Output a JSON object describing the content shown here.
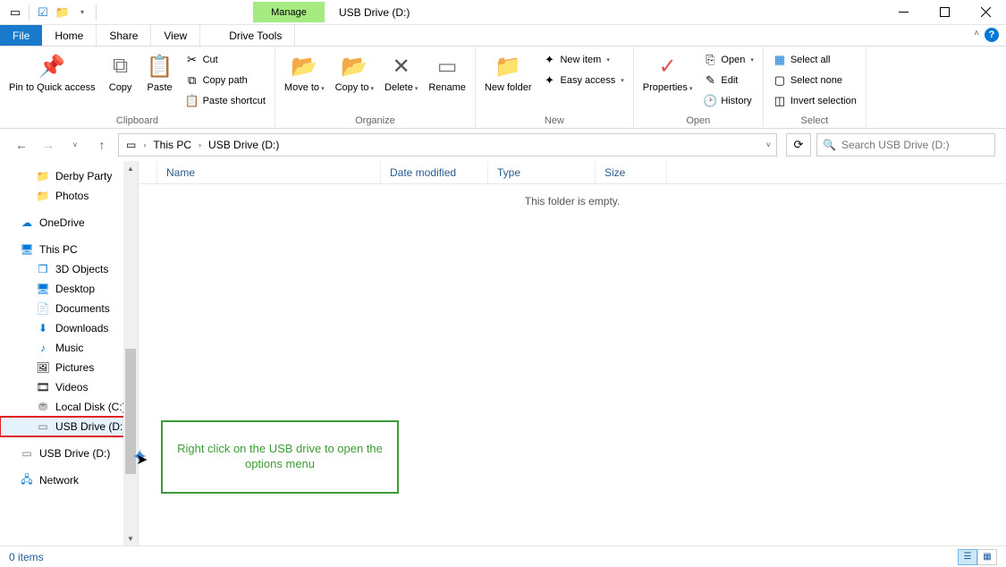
{
  "titlebar": {
    "manage": "Manage",
    "title": "USB Drive (D:)"
  },
  "tabs": {
    "file": "File",
    "home": "Home",
    "share": "Share",
    "view": "View",
    "drivetools": "Drive Tools"
  },
  "ribbon": {
    "clipboard": {
      "label": "Clipboard",
      "pin": "Pin to Quick access",
      "copy": "Copy",
      "paste": "Paste",
      "cut": "Cut",
      "copypath": "Copy path",
      "pasteshortcut": "Paste shortcut"
    },
    "organize": {
      "label": "Organize",
      "moveto": "Move to",
      "copyto": "Copy to",
      "delete": "Delete",
      "rename": "Rename"
    },
    "new": {
      "label": "New",
      "newfolder": "New folder",
      "newitem": "New item",
      "easyaccess": "Easy access"
    },
    "open": {
      "label": "Open",
      "properties": "Properties",
      "open": "Open",
      "edit": "Edit",
      "history": "History"
    },
    "select": {
      "label": "Select",
      "selectall": "Select all",
      "selectnone": "Select none",
      "invert": "Invert selection"
    }
  },
  "breadcrumb": {
    "thispc": "This PC",
    "drive": "USB Drive (D:)"
  },
  "search": {
    "placeholder": "Search USB Drive (D:)"
  },
  "columns": {
    "name": "Name",
    "date": "Date modified",
    "type": "Type",
    "size": "Size"
  },
  "empty": "This folder is empty.",
  "tree": {
    "derby": "Derby Party",
    "photos": "Photos",
    "onedrive": "OneDrive",
    "thispc": "This PC",
    "objects3d": "3D Objects",
    "desktop": "Desktop",
    "documents": "Documents",
    "downloads": "Downloads",
    "music": "Music",
    "pictures": "Pictures",
    "videos": "Videos",
    "localdisk": "Local Disk (C:)",
    "usbd": "USB Drive (D:)",
    "usbd2": "USB Drive (D:)",
    "network": "Network"
  },
  "callout": "Right click on the USB drive to open the options menu",
  "status": {
    "items": "0 items"
  }
}
